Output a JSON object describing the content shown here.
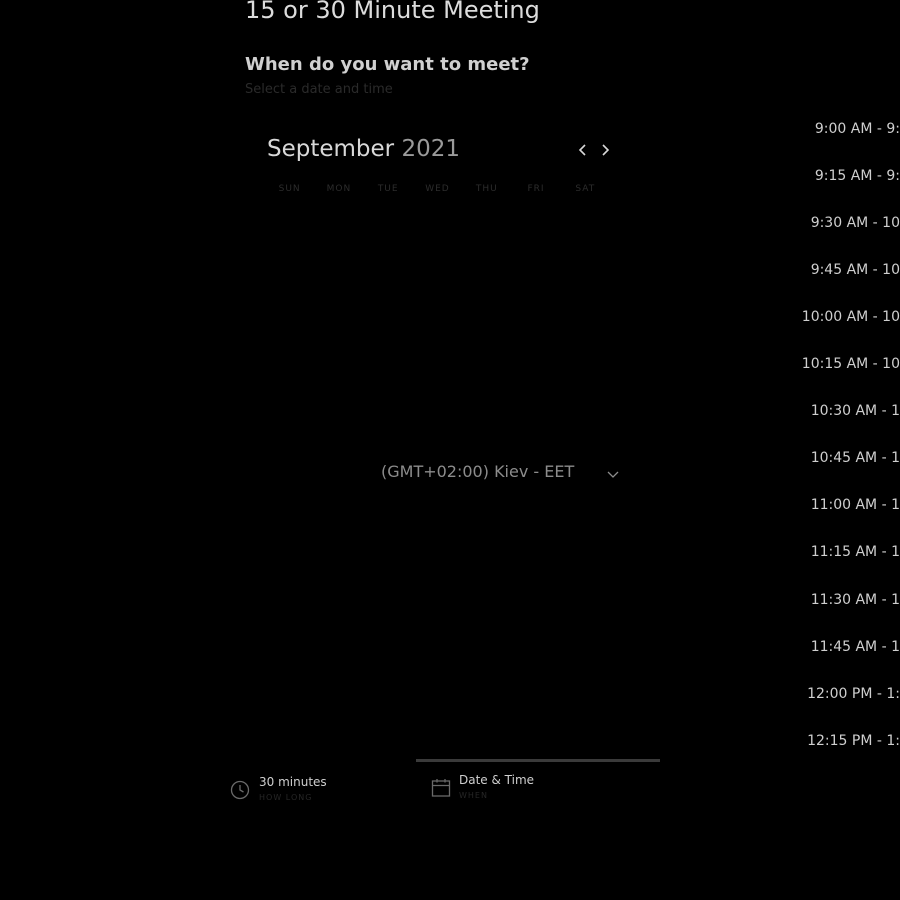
{
  "header": {
    "title": "15 or 30 Minute Meeting",
    "heading": "When do you want to meet?",
    "subheading": "Select a date and time"
  },
  "calendar": {
    "month": "September",
    "year": "2021",
    "weekdays": [
      "SUN",
      "MON",
      "TUE",
      "WED",
      "THU",
      "FRI",
      "SAT"
    ],
    "prev_icon": "chevron-left-icon",
    "next_icon": "chevron-right-icon"
  },
  "timezone": {
    "value": "(GMT+02:00) Kiev - EET",
    "icon": "chevron-down-icon"
  },
  "time_slots": [
    "9:00 AM - 9:",
    "9:15 AM - 9:",
    "9:30 AM - 10",
    "9:45 AM - 10",
    "10:00 AM - 10",
    "10:15 AM - 10",
    "10:30 AM - 1",
    "10:45 AM - 1",
    "11:00 AM - 1",
    "11:15 AM - 1",
    "11:30 AM - 1",
    "11:45 AM - 1",
    "12:00 PM - 1:",
    "12:15 PM - 1:"
  ],
  "steps": {
    "duration": {
      "label": "30 minutes",
      "sub": "HOW LONG",
      "icon": "clock-icon"
    },
    "datetime": {
      "label": "Date & Time",
      "sub": "WHEN",
      "icon": "calendar-icon"
    }
  }
}
